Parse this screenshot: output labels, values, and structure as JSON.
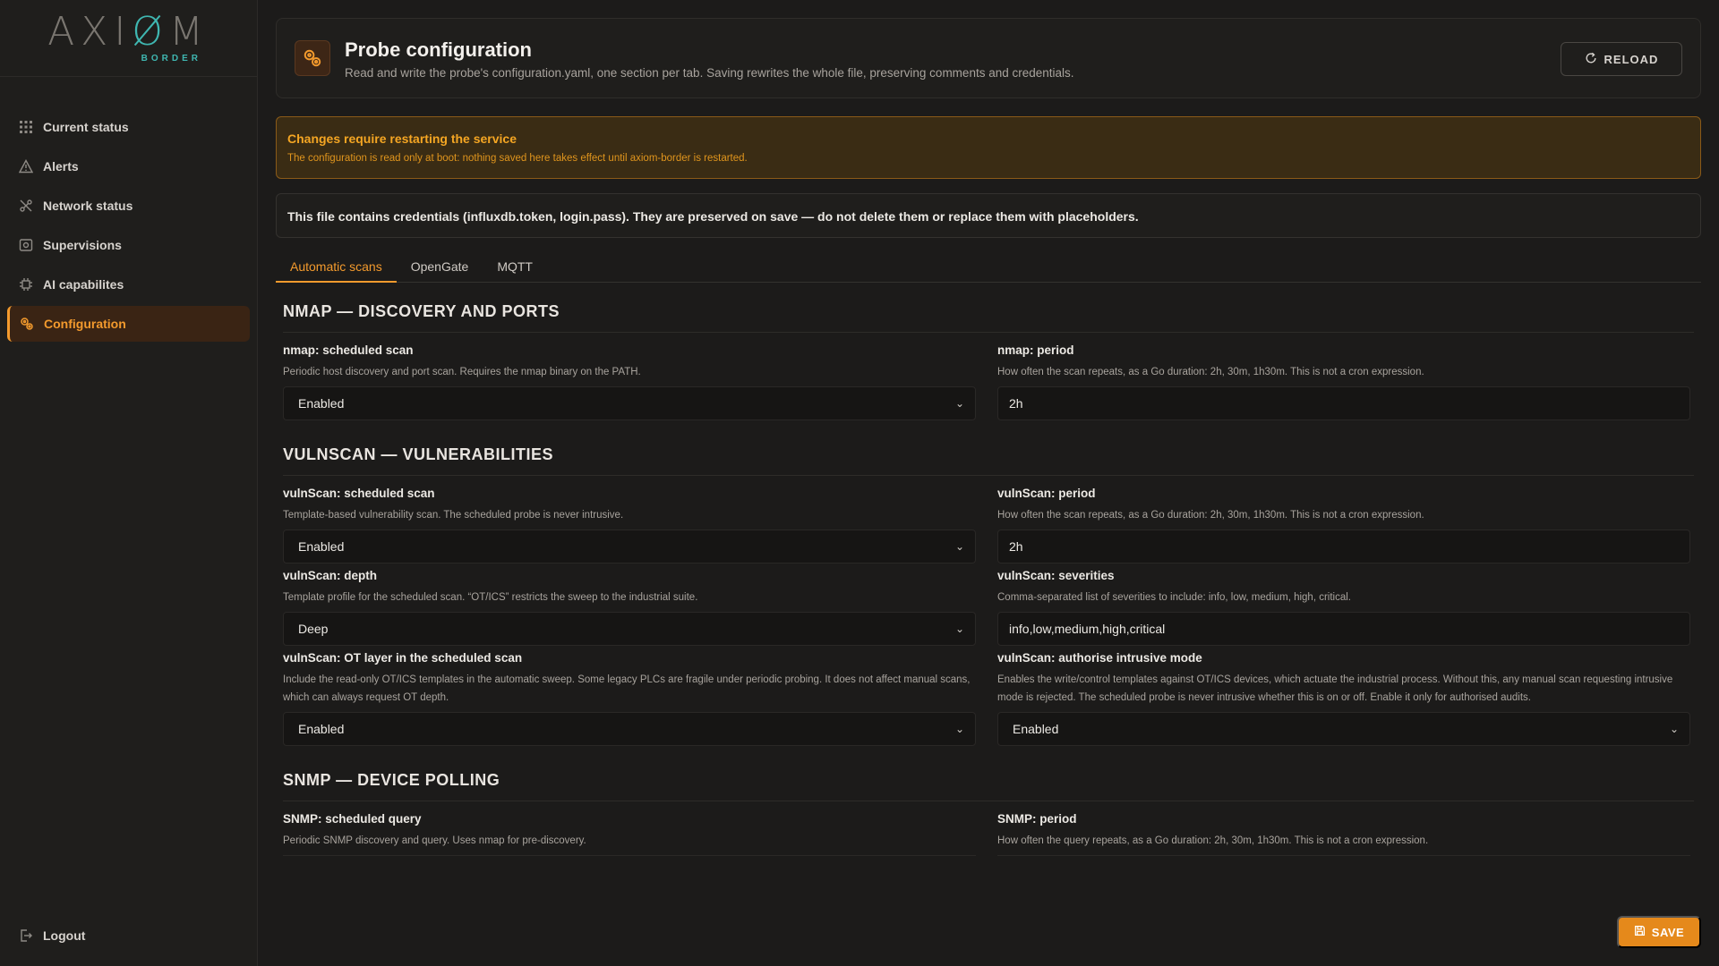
{
  "brand": {
    "word_a": "AXI",
    "word_b": "Ø",
    "word_c": "M",
    "sub": "BORDER"
  },
  "sidebar": {
    "items": [
      {
        "label": "Current status",
        "icon": "grid-icon"
      },
      {
        "label": "Alerts",
        "icon": "warning-icon"
      },
      {
        "label": "Network status",
        "icon": "network-icon"
      },
      {
        "label": "Supervisions",
        "icon": "supervision-icon"
      },
      {
        "label": "AI capabilites",
        "icon": "chip-icon"
      },
      {
        "label": "Configuration",
        "icon": "gears-icon",
        "active": true
      }
    ],
    "logout": "Logout"
  },
  "header": {
    "title": "Probe configuration",
    "subtitle": "Read and write the probe's configuration.yaml, one section per tab. Saving rewrites the whole file, preserving comments and credentials.",
    "reload_label": "RELOAD"
  },
  "warning": {
    "title": "Changes require restarting the service",
    "text": "The configuration is read only at boot: nothing saved here takes effect until axiom-border is restarted."
  },
  "info": "This file contains credentials (influxdb.token, login.pass). They are preserved on save — do not delete them or replace them with placeholders.",
  "tabs": [
    "Automatic scans",
    "OpenGate",
    "MQTT"
  ],
  "active_tab": "Automatic scans",
  "sections": {
    "nmap": {
      "title": "NMAP — DISCOVERY AND PORTS",
      "scheduled": {
        "label": "nmap: scheduled scan",
        "help": "Periodic host discovery and port scan. Requires the nmap binary on the PATH.",
        "value": "Enabled"
      },
      "period": {
        "label": "nmap: period",
        "help": "How often the scan repeats, as a Go duration: 2h, 30m, 1h30m. This is not a cron expression.",
        "value": "2h"
      }
    },
    "vuln": {
      "title": "VULNSCAN — VULNERABILITIES",
      "scheduled": {
        "label": "vulnScan: scheduled scan",
        "help": "Template-based vulnerability scan. The scheduled probe is never intrusive.",
        "value": "Enabled"
      },
      "period": {
        "label": "vulnScan: period",
        "help": "How often the scan repeats, as a Go duration: 2h, 30m, 1h30m. This is not a cron expression.",
        "value": "2h"
      },
      "depth": {
        "label": "vulnScan: depth",
        "help": "Template profile for the scheduled scan. “OT/ICS” restricts the sweep to the industrial suite.",
        "value": "Deep"
      },
      "severities": {
        "label": "vulnScan: severities",
        "help": "Comma-separated list of severities to include: info, low, medium, high, critical.",
        "value": "info,low,medium,high,critical"
      },
      "ot": {
        "label": "vulnScan: OT layer in the scheduled scan",
        "help": "Include the read-only OT/ICS templates in the automatic sweep. Some legacy PLCs are fragile under periodic probing. It does not affect manual scans, which can always request OT depth.",
        "value": "Enabled"
      },
      "intrusive": {
        "label": "vulnScan: authorise intrusive mode",
        "help": "Enables the write/control templates against OT/ICS devices, which actuate the industrial process. Without this, any manual scan requesting intrusive mode is rejected. The scheduled probe is never intrusive whether this is on or off. Enable it only for authorised audits.",
        "value": "Enabled"
      }
    },
    "snmp": {
      "title": "SNMP — DEVICE POLLING",
      "scheduled": {
        "label": "SNMP: scheduled query",
        "help": "Periodic SNMP discovery and query. Uses nmap for pre-discovery."
      },
      "period": {
        "label": "SNMP: period",
        "help": "How often the query repeats, as a Go duration: 2h, 30m, 1h30m. This is not a cron expression."
      }
    }
  },
  "save_label": "SAVE",
  "colors": {
    "accent": "#f39a2d",
    "teal": "#3fb7b1",
    "warning_bg": "#3a2c14"
  }
}
